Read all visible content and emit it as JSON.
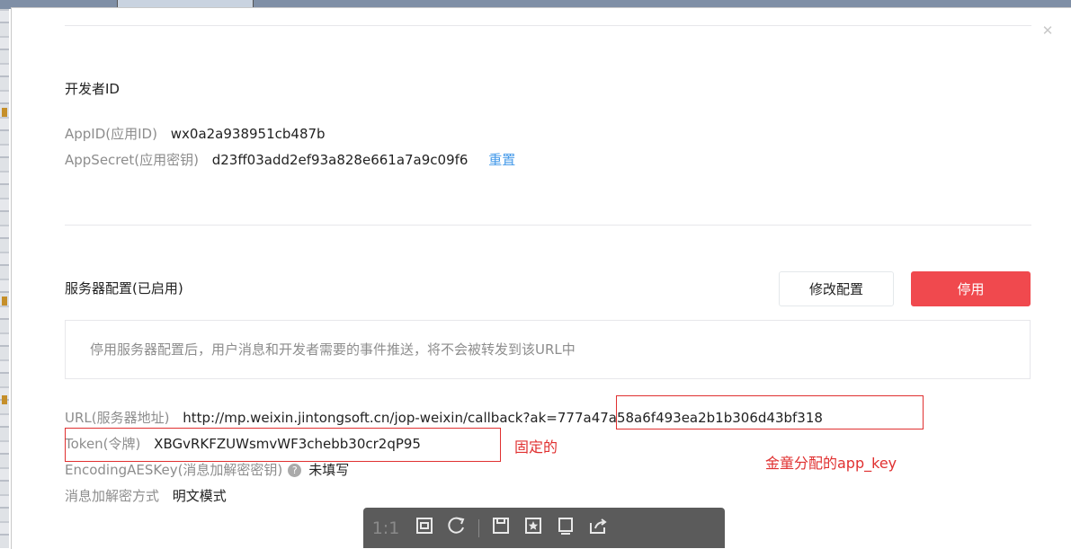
{
  "dialog": {
    "close_icon": "close-icon",
    "developer_section": {
      "title": "开发者ID",
      "appid_label": "AppID(应用ID)",
      "appid_value": "wx0a2a938951cb487b",
      "appsecret_label": "AppSecret(应用密钥)",
      "appsecret_value": "d23ff03add2ef93a828e661a7a9c09f6",
      "reset_link": "重置"
    },
    "server_section": {
      "title": "服务器配置(已启用)",
      "modify_button": "修改配置",
      "disable_button": "停用",
      "notice": "停用服务器配置后，用户消息和开发者需要的事件推送，将不会被转发到该URL中",
      "url_label": "URL(服务器地址)",
      "url_value_prefix": "http://mp.weixin.jintongsoft.cn/jop-weixin/callback?ak",
      "url_value_key": "=777a47a58a6f493ea2b1b306d43bf318",
      "token_label": "Token(令牌)",
      "token_value": "XBGvRKFZUWsmvWF3chebb30cr2qP95",
      "aes_label": "EncodingAESKey(消息加解密密钥)",
      "aes_value": "未填写",
      "mode_label": "消息加解密方式",
      "mode_value": "明文模式"
    }
  },
  "annotations": {
    "fixed": "固定的",
    "app_key": "金童分配的app_key"
  },
  "viewer_toolbar": {
    "ratio_label": "1:1",
    "icons": [
      "fit-screen-icon",
      "rotate-icon",
      "save-icon",
      "bookmark-icon",
      "fullscreen-icon",
      "share-icon"
    ]
  },
  "colors": {
    "primary_red": "#f0494e",
    "link_blue": "#459ae9",
    "annotation_red": "#e03030"
  }
}
